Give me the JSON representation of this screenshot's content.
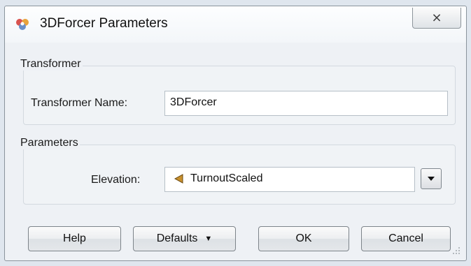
{
  "window": {
    "title": "3DForcer Parameters",
    "close_glyph": "⨯",
    "icon": "fme-transformer-icon"
  },
  "transformer_group": {
    "title": "Transformer",
    "name_label": "Transformer Name:",
    "name_value": "3DForcer"
  },
  "parameters_group": {
    "title": "Parameters",
    "elevation_label": "Elevation:",
    "elevation_value": "TurnoutScaled",
    "elevation_icon": "attribute-icon"
  },
  "buttons": {
    "help": "Help",
    "defaults": "Defaults",
    "ok": "OK",
    "cancel": "Cancel"
  }
}
